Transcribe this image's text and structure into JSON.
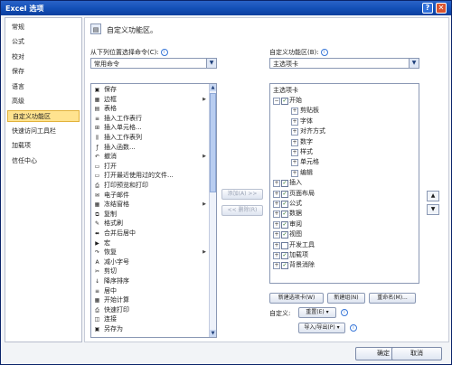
{
  "window": {
    "title": "Excel 选项",
    "help_glyph": "?",
    "close_glyph": "✕"
  },
  "nav": {
    "items": [
      {
        "label": "常规",
        "active": false
      },
      {
        "label": "公式",
        "active": false
      },
      {
        "label": "校对",
        "active": false
      },
      {
        "label": "保存",
        "active": false
      },
      {
        "label": "语言",
        "active": false
      },
      {
        "label": "高级",
        "active": false
      },
      {
        "label": "自定义功能区",
        "active": true
      },
      {
        "label": "快速访问工具栏",
        "active": false
      },
      {
        "label": "加载项",
        "active": false
      },
      {
        "label": "信任中心",
        "active": false
      }
    ],
    "active_color": "#ffe38f"
  },
  "header": {
    "title": "自定义功能区。"
  },
  "left": {
    "label": "从下列位置选择命令(C):",
    "dropdown_value": "常用命令",
    "commands": [
      {
        "label": "保存",
        "icon": "save-icon",
        "glyph": "▣",
        "sub": ""
      },
      {
        "label": "边框",
        "icon": "border-icon",
        "glyph": "▦",
        "sub": "▶"
      },
      {
        "label": "表格",
        "icon": "table-icon",
        "glyph": "▤",
        "sub": ""
      },
      {
        "label": "插入工作表行",
        "icon": "insert-row-icon",
        "glyph": "≡",
        "sub": ""
      },
      {
        "label": "插入单元格...",
        "icon": "insert-cell-icon",
        "glyph": "⊞",
        "sub": ""
      },
      {
        "label": "插入工作表列",
        "icon": "insert-column-icon",
        "glyph": "⫼",
        "sub": ""
      },
      {
        "label": "插入函数...",
        "icon": "function-icon",
        "glyph": "ƒ",
        "sub": ""
      },
      {
        "label": "撤消",
        "icon": "undo-icon",
        "glyph": "↶",
        "sub": "▶"
      },
      {
        "label": "打开",
        "icon": "open-icon",
        "glyph": "▭",
        "sub": ""
      },
      {
        "label": "打开最近使用过的文件...",
        "icon": "recent-file-icon",
        "glyph": "▭",
        "sub": ""
      },
      {
        "label": "打印预览和打印",
        "icon": "print-preview-icon",
        "glyph": "⎙",
        "sub": ""
      },
      {
        "label": "电子邮件",
        "icon": "email-icon",
        "glyph": "✉",
        "sub": ""
      },
      {
        "label": "冻结窗格",
        "icon": "freeze-panes-icon",
        "glyph": "▦",
        "sub": "▶"
      },
      {
        "label": "复制",
        "icon": "copy-icon",
        "glyph": "⧉",
        "sub": ""
      },
      {
        "label": "格式刷",
        "icon": "format-painter-icon",
        "glyph": "✎",
        "sub": ""
      },
      {
        "label": "合并后居中",
        "icon": "merge-center-icon",
        "glyph": "⬌",
        "sub": ""
      },
      {
        "label": "宏",
        "icon": "macro-icon",
        "glyph": "▶",
        "sub": ""
      },
      {
        "label": "恢复",
        "icon": "redo-icon",
        "glyph": "↷",
        "sub": "▶"
      },
      {
        "label": "减小字号",
        "icon": "decrease-font-icon",
        "glyph": "A",
        "sub": ""
      },
      {
        "label": "剪切",
        "icon": "cut-icon",
        "glyph": "✂",
        "sub": ""
      },
      {
        "label": "降序排序",
        "icon": "sort-desc-icon",
        "glyph": "↓",
        "sub": ""
      },
      {
        "label": "居中",
        "icon": "center-icon",
        "glyph": "≡",
        "sub": ""
      },
      {
        "label": "开始计算",
        "icon": "calculate-icon",
        "glyph": "▦",
        "sub": ""
      },
      {
        "label": "快速打印",
        "icon": "quick-print-icon",
        "glyph": "⎙",
        "sub": ""
      },
      {
        "label": "连接",
        "icon": "connections-icon",
        "glyph": "◫",
        "sub": ""
      },
      {
        "label": "另存为",
        "icon": "save-as-icon",
        "glyph": "▣",
        "sub": ""
      }
    ]
  },
  "mid": {
    "add": "添加(A) >>",
    "remove": "<< 删除(R)"
  },
  "right": {
    "label": "自定义功能区(B):",
    "dropdown_value": "主选项卡",
    "tree_header": "主选项卡",
    "tree": [
      {
        "label": "开始",
        "level": 0,
        "expander": "⊟",
        "checked": true
      },
      {
        "label": "剪贴板",
        "level": 1,
        "expander": "⊞",
        "checked": null
      },
      {
        "label": "字体",
        "level": 1,
        "expander": "⊞",
        "checked": null
      },
      {
        "label": "对齐方式",
        "level": 1,
        "expander": "⊞",
        "checked": null
      },
      {
        "label": "数字",
        "level": 1,
        "expander": "⊞",
        "checked": null
      },
      {
        "label": "样式",
        "level": 1,
        "expander": "⊞",
        "checked": null
      },
      {
        "label": "单元格",
        "level": 1,
        "expander": "⊞",
        "checked": null
      },
      {
        "label": "编辑",
        "level": 1,
        "expander": "⊞",
        "checked": null
      },
      {
        "label": "插入",
        "level": 0,
        "expander": "⊞",
        "checked": true
      },
      {
        "label": "页面布局",
        "level": 0,
        "expander": "⊞",
        "checked": true
      },
      {
        "label": "公式",
        "level": 0,
        "expander": "⊞",
        "checked": true
      },
      {
        "label": "数据",
        "level": 0,
        "expander": "⊞",
        "checked": true
      },
      {
        "label": "审阅",
        "level": 0,
        "expander": "⊞",
        "checked": true
      },
      {
        "label": "视图",
        "level": 0,
        "expander": "⊞",
        "checked": true
      },
      {
        "label": "开发工具",
        "level": 0,
        "expander": "⊞",
        "checked": false
      },
      {
        "label": "加载项",
        "level": 0,
        "expander": "⊞",
        "checked": true
      },
      {
        "label": "背景消除",
        "level": 0,
        "expander": "⊞",
        "checked": true
      }
    ],
    "move_up": "▲",
    "move_down": "▼",
    "new_tab": "新建选项卡(W)",
    "new_group": "新建组(N)",
    "rename": "重命名(M)...",
    "custom_label": "自定义:",
    "reset": "重置(E) ▾",
    "import_export": "导入/导出(P) ▾"
  },
  "footer": {
    "ok": "确定",
    "cancel": "取消"
  },
  "help_glyph": "i",
  "checkmark": "✓"
}
